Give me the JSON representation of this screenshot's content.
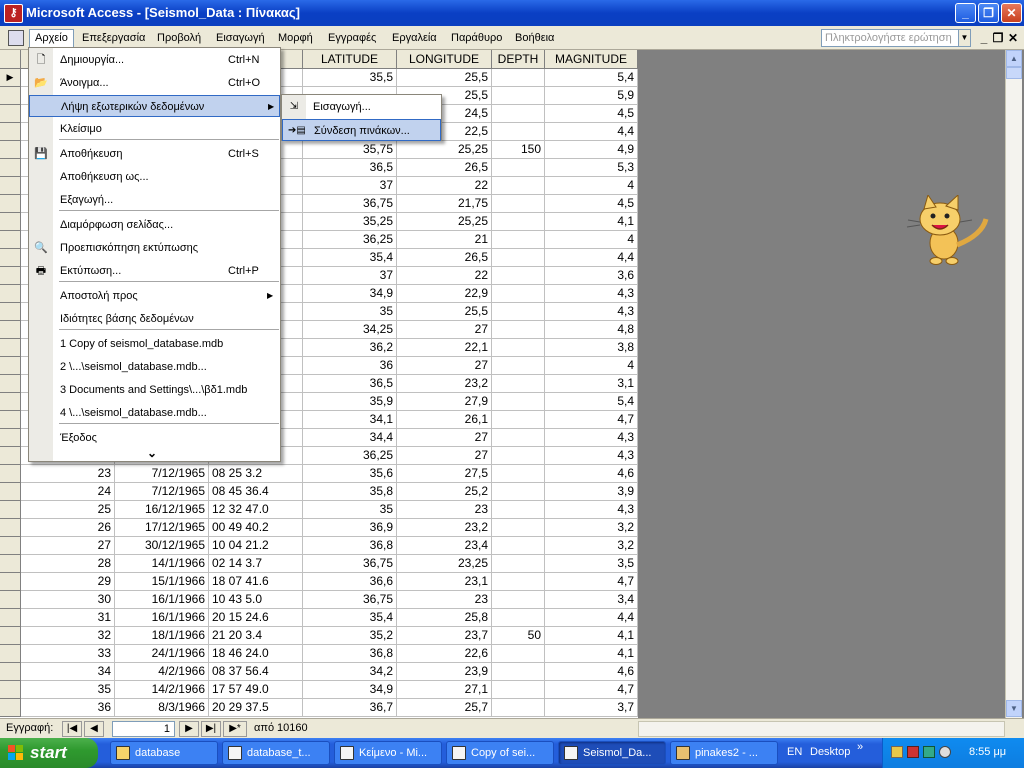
{
  "window": {
    "title": "Microsoft Access - [Seismol_Data : Πίνακας]",
    "app_icon": "access-key-icon"
  },
  "menubar": {
    "items": [
      "Αρχείο",
      "Επεξεργασία",
      "Προβολή",
      "Εισαγωγή",
      "Μορφή",
      "Εγγραφές",
      "Εργαλεία",
      "Παράθυρο",
      "Βοήθεια"
    ],
    "help_placeholder": "Πληκτρολογήστε ερώτηση"
  },
  "grid": {
    "columns": [
      "LATITUDE",
      "LONGITUDE",
      "DEPTH",
      "MAGNITUDE"
    ],
    "top_rows": [
      {
        "lat": "35,5",
        "lon": "25,5",
        "depth": "",
        "mag": "5,4"
      },
      {
        "lat": "",
        "lon": "25,5",
        "depth": "",
        "mag": "5,9"
      },
      {
        "lat": "",
        "lon": "24,5",
        "depth": "",
        "mag": "4,5"
      },
      {
        "lat": "",
        "lon": "22,5",
        "depth": "",
        "mag": "4,4"
      },
      {
        "lat": "35,75",
        "lon": "25,25",
        "depth": "150",
        "mag": "4,9"
      },
      {
        "lat": "36,5",
        "lon": "26,5",
        "depth": "",
        "mag": "5,3"
      },
      {
        "lat": "37",
        "lon": "22",
        "depth": "",
        "mag": "4"
      },
      {
        "lat": "36,75",
        "lon": "21,75",
        "depth": "",
        "mag": "4,5"
      },
      {
        "lat": "35,25",
        "lon": "25,25",
        "depth": "",
        "mag": "4,1"
      },
      {
        "lat": "36,25",
        "lon": "21",
        "depth": "",
        "mag": "4"
      },
      {
        "lat": "35,4",
        "lon": "26,5",
        "depth": "",
        "mag": "4,4"
      },
      {
        "lat": "37",
        "lon": "22",
        "depth": "",
        "mag": "3,6"
      },
      {
        "lat": "34,9",
        "lon": "22,9",
        "depth": "",
        "mag": "4,3"
      },
      {
        "lat": "35",
        "lon": "25,5",
        "depth": "",
        "mag": "4,3"
      },
      {
        "lat": "34,25",
        "lon": "27",
        "depth": "",
        "mag": "4,8"
      },
      {
        "lat": "36,2",
        "lon": "22,1",
        "depth": "",
        "mag": "3,8"
      },
      {
        "lat": "36",
        "lon": "27",
        "depth": "",
        "mag": "4"
      },
      {
        "lat": "36,5",
        "lon": "23,2",
        "depth": "",
        "mag": "3,1"
      },
      {
        "lat": "35,9",
        "lon": "27,9",
        "depth": "",
        "mag": "5,4"
      },
      {
        "lat": "34,1",
        "lon": "26,1",
        "depth": "",
        "mag": "4,7"
      },
      {
        "lat": "34,4",
        "lon": "27",
        "depth": "",
        "mag": "4,3"
      },
      {
        "lat": "36,25",
        "lon": "27",
        "depth": "",
        "mag": "4,3"
      }
    ],
    "full_rows": [
      {
        "id": "23",
        "date": "7/12/1965",
        "time": "08 25 3.2",
        "lat": "35,6",
        "lon": "27,5",
        "depth": "",
        "mag": "4,6"
      },
      {
        "id": "24",
        "date": "7/12/1965",
        "time": "08 45 36.4",
        "lat": "35,8",
        "lon": "25,2",
        "depth": "",
        "mag": "3,9"
      },
      {
        "id": "25",
        "date": "16/12/1965",
        "time": "12 32 47.0",
        "lat": "35",
        "lon": "23",
        "depth": "",
        "mag": "4,3"
      },
      {
        "id": "26",
        "date": "17/12/1965",
        "time": "00 49 40.2",
        "lat": "36,9",
        "lon": "23,2",
        "depth": "",
        "mag": "3,2"
      },
      {
        "id": "27",
        "date": "30/12/1965",
        "time": "10 04 21.2",
        "lat": "36,8",
        "lon": "23,4",
        "depth": "",
        "mag": "3,2"
      },
      {
        "id": "28",
        "date": "14/1/1966",
        "time": "02 14 3.7",
        "lat": "36,75",
        "lon": "23,25",
        "depth": "",
        "mag": "3,5"
      },
      {
        "id": "29",
        "date": "15/1/1966",
        "time": "18 07 41.6",
        "lat": "36,6",
        "lon": "23,1",
        "depth": "",
        "mag": "4,7"
      },
      {
        "id": "30",
        "date": "16/1/1966",
        "time": "10 43 5.0",
        "lat": "36,75",
        "lon": "23",
        "depth": "",
        "mag": "3,4"
      },
      {
        "id": "31",
        "date": "16/1/1966",
        "time": "20 15 24.6",
        "lat": "35,4",
        "lon": "25,8",
        "depth": "",
        "mag": "4,4"
      },
      {
        "id": "32",
        "date": "18/1/1966",
        "time": "21 20 3.4",
        "lat": "35,2",
        "lon": "23,7",
        "depth": "50",
        "mag": "4,1"
      },
      {
        "id": "33",
        "date": "24/1/1966",
        "time": "18 46 24.0",
        "lat": "36,8",
        "lon": "22,6",
        "depth": "",
        "mag": "4,1"
      },
      {
        "id": "34",
        "date": "4/2/1966",
        "time": "08 37 56.4",
        "lat": "34,2",
        "lon": "23,9",
        "depth": "",
        "mag": "4,6"
      },
      {
        "id": "35",
        "date": "14/2/1966",
        "time": "17 57 49.0",
        "lat": "34,9",
        "lon": "27,1",
        "depth": "",
        "mag": "4,7"
      },
      {
        "id": "36",
        "date": "8/3/1966",
        "time": "20 29 37.5",
        "lat": "36,7",
        "lon": "25,7",
        "depth": "",
        "mag": "3,7"
      }
    ]
  },
  "file_menu": {
    "items": [
      {
        "label": "Δημιουργία...",
        "shortcut": "Ctrl+N",
        "icon": "new-doc-icon"
      },
      {
        "label": "Άνοιγμα...",
        "shortcut": "Ctrl+O",
        "icon": "open-folder-icon"
      },
      {
        "label": "Λήψη εξωτερικών δεδομένων",
        "shortcut": "",
        "icon": ""
      },
      {
        "label": "Κλείσιμο",
        "shortcut": "",
        "icon": ""
      },
      {
        "label": "Αποθήκευση",
        "shortcut": "Ctrl+S",
        "icon": "floppy-icon"
      },
      {
        "label": "Αποθήκευση ως...",
        "shortcut": "",
        "icon": ""
      },
      {
        "label": "Εξαγωγή...",
        "shortcut": "",
        "icon": ""
      },
      {
        "label": "Διαμόρφωση σελίδας...",
        "shortcut": "",
        "icon": ""
      },
      {
        "label": "Προεπισκόπηση εκτύπωσης",
        "shortcut": "",
        "icon": "print-preview-icon"
      },
      {
        "label": "Εκτύπωση...",
        "shortcut": "Ctrl+P",
        "icon": "printer-icon"
      },
      {
        "label": "Αποστολή προς",
        "shortcut": "",
        "icon": ""
      },
      {
        "label": "Ιδιότητες βάσης δεδομένων",
        "shortcut": "",
        "icon": ""
      },
      {
        "label": "1 Copy of seismol_database.mdb",
        "shortcut": "",
        "icon": ""
      },
      {
        "label": "2 \\...\\seismol_database.mdb...",
        "shortcut": "",
        "icon": ""
      },
      {
        "label": "3 Documents and Settings\\...\\βδ1.mdb",
        "shortcut": "",
        "icon": ""
      },
      {
        "label": "4 \\...\\seismol_database.mdb...",
        "shortcut": "",
        "icon": ""
      },
      {
        "label": "Έξοδος",
        "shortcut": "",
        "icon": ""
      }
    ],
    "expand_glyph": "⌄"
  },
  "submenu": {
    "items": [
      {
        "label": "Εισαγωγή...",
        "icon": "import-icon"
      },
      {
        "label": "Σύνδεση πινάκων...",
        "icon": "link-tables-icon"
      }
    ]
  },
  "navbar": {
    "label": "Εγγραφή:",
    "record": "1",
    "of_label": "από",
    "total": "10160"
  },
  "taskbar": {
    "start_label": "start",
    "tasks": [
      "database",
      "database_t...",
      "Κείμενο - Mi...",
      "Copy of sei...",
      "Seismol_Da...",
      "pinakes2 - ..."
    ],
    "lang": "EN",
    "desktop_label": "Desktop",
    "clock": "8:55 μμ"
  },
  "colors": {
    "selection": "#316ac5",
    "highlight": "#c1d2ee",
    "title_blue": "#0a3fc4"
  }
}
